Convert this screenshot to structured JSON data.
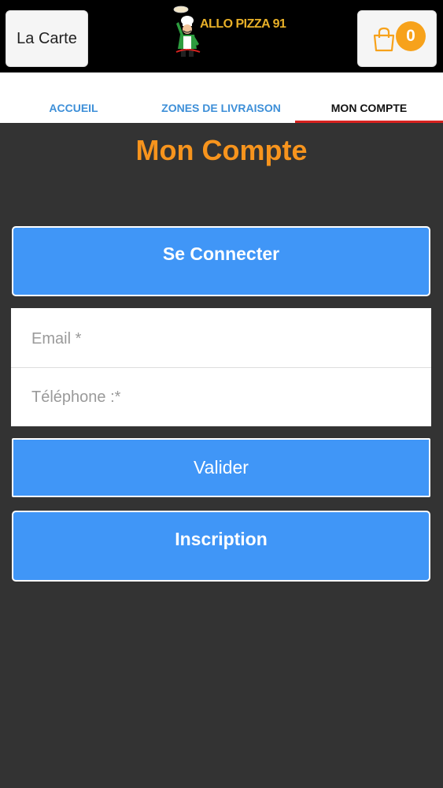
{
  "header": {
    "menu_button_label": "La Carte",
    "logo_text": "ALLO PIZZA 91",
    "cart_count": "0",
    "cart_icon": "shopping-bag-icon"
  },
  "tabs": [
    {
      "label": "ACCUEIL",
      "active": false
    },
    {
      "label": "ZONES DE LIVRAISON",
      "active": false
    },
    {
      "label": "MON COMPTE",
      "active": true
    }
  ],
  "page": {
    "title": "Mon Compte",
    "connect_label": "Se Connecter",
    "email_placeholder": "Email *",
    "phone_placeholder": "Téléphone :*",
    "validate_label": "Valider",
    "signup_label": "Inscription"
  },
  "colors": {
    "background": "#333333",
    "accent_orange": "#f7941d",
    "button_blue": "#4096f7",
    "tab_blue": "#3d8fd8",
    "active_tab_underline": "#d7221f",
    "badge": "#f7a21b"
  }
}
